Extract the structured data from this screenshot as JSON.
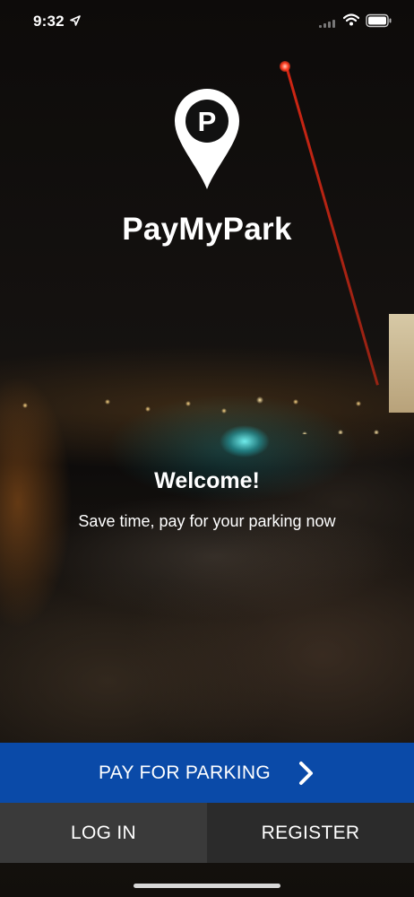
{
  "status_bar": {
    "time": "9:32",
    "icons": [
      "location-arrow-icon",
      "cellular-signal-icon",
      "wifi-icon",
      "battery-icon"
    ]
  },
  "app": {
    "logo_letter": "P",
    "name": "PayMyPark"
  },
  "hero": {
    "welcome": "Welcome!",
    "tagline": "Save time, pay for your parking now"
  },
  "actions": {
    "pay_label": "PAY FOR PARKING",
    "pay_icon": "chevron-right-icon",
    "login_label": "LOG IN",
    "register_label": "REGISTER"
  },
  "colors": {
    "primary": "#0a4aa8",
    "login_bg": "#3a3a3a",
    "register_bg": "#2b2b2b"
  }
}
